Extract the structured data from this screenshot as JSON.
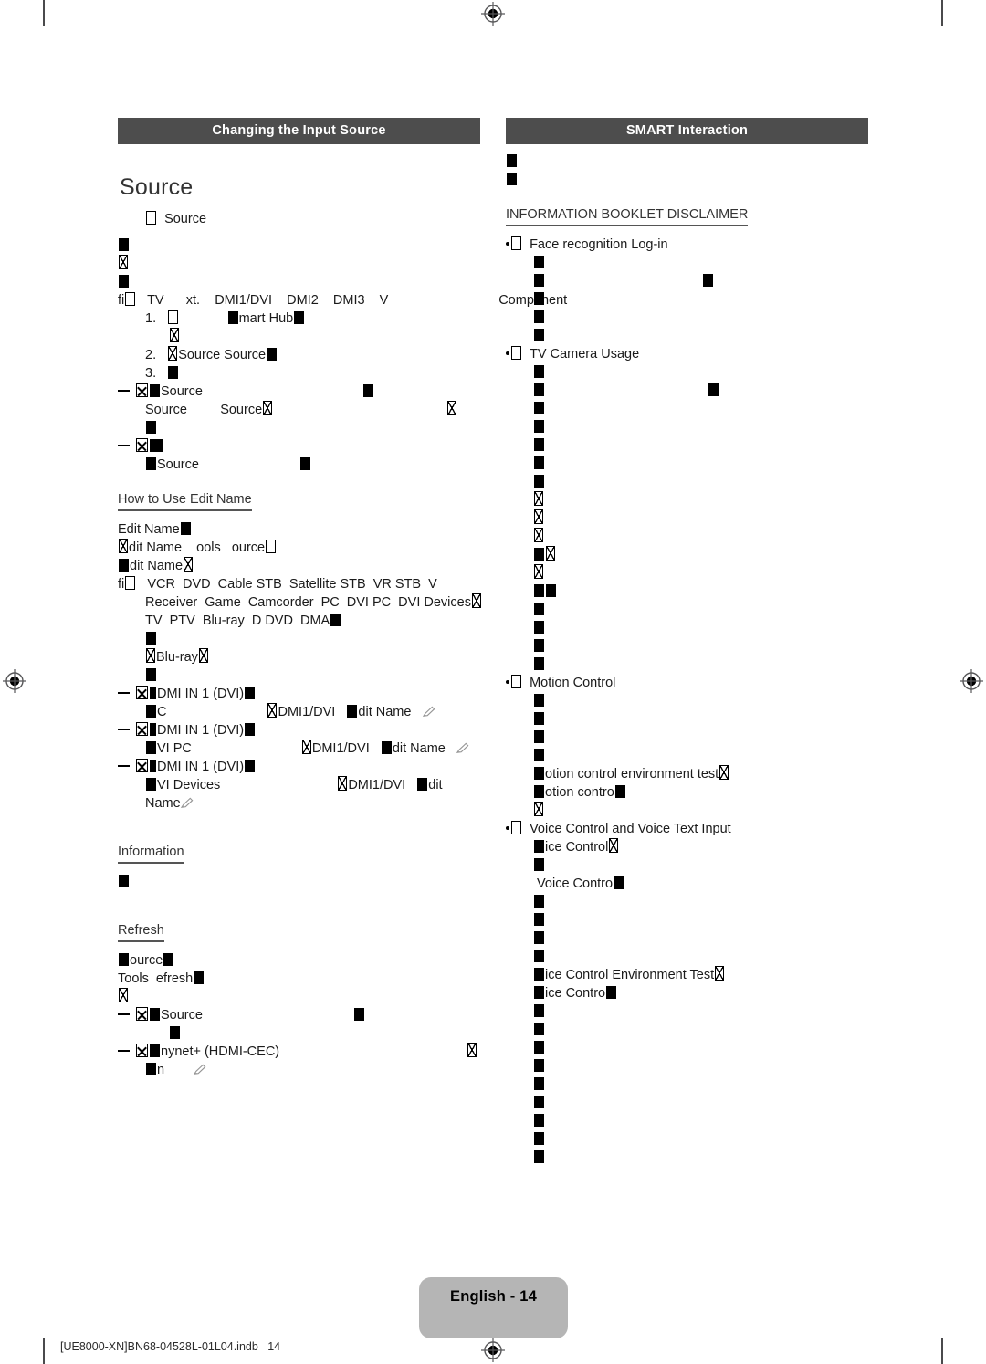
{
  "document": {
    "page_label": "English - 14",
    "file_reference": "[UE8000-XN]BN68-04528L-01L04.indb   14",
    "print_marks": {
      "registration_icon": "registration-target-icon",
      "crop_mark": "crop-mark"
    }
  },
  "left_column": {
    "section_bar": "Changing the Input Source",
    "heading": "Source",
    "menu_line": "Source",
    "input_list": "TV      xt.    DMI1/DVI    DMI2    DMI3    V                              Component",
    "steps": [
      {
        "num": "1.",
        "text": "mart Hub"
      },
      {
        "num": "2.",
        "text": "Source Source"
      },
      {
        "num": "3.",
        "text": ""
      }
    ],
    "note_1_title": "Source",
    "note_1_body": "Source         Source",
    "note_2_title": "",
    "note_2_body": "Source",
    "edit_name": {
      "heading": "How to Use Edit Name",
      "line1": "Edit Name",
      "line2": "dit Name    ools   ource",
      "line3": "dit Name",
      "list_line1": "VCR  DVD  Cable STB  Satellite STB  VR STB  V",
      "list_line2": "Receiver  Game  Camcorder  PC  DVI PC  DVI Devices",
      "list_line3": "TV  PTV  Blu-ray  D DVD  DMA",
      "list_line4": "",
      "list_line5": "Blu-ray",
      "items": [
        {
          "label": "DMI IN 1 (DVI)",
          "detail_left": "C",
          "detail_mid": "DMI1/DVI",
          "detail_right": "dit Name"
        },
        {
          "label": "DMI IN 1 (DVI)",
          "detail_left": "VI PC",
          "detail_mid": "DMI1/DVI",
          "detail_right": "dit Name"
        },
        {
          "label": "DMI IN 1 (DVI)",
          "detail_left": "VI Devices",
          "detail_mid": "DMI1/DVI",
          "detail_right": "dit"
        },
        {
          "label": "Name",
          "detail_left": "",
          "detail_mid": "",
          "detail_right": ""
        }
      ]
    },
    "information": {
      "heading": "Information"
    },
    "refresh": {
      "heading": "Refresh",
      "line1": "ource",
      "line2": "Tools  efresh",
      "sub1": "Source",
      "sub2": "nynet+ (HDMI-CEC)",
      "sub2_detail": "n"
    }
  },
  "right_column": {
    "section_bar": "SMART Interaction",
    "disclaimer_heading": "INFORMATION BOOKLET DISCLAIMER",
    "topics": [
      {
        "title": "Face recognition Log-in"
      },
      {
        "title": "TV Camera Usage"
      },
      {
        "title": "Motion Control"
      },
      {
        "title": "Voice Control and Voice Text Input"
      }
    ],
    "motion_control_lines": [
      "otion control environment test",
      "otion contro"
    ],
    "voice_lines": [
      "ice Control",
      "Voice Contro",
      "ice Control Environment Test",
      "ice Contro"
    ]
  },
  "colors": {
    "section_bar_bg": "#4d4d4d",
    "section_bar_text": "#ffffff",
    "page_pill_bg": "#b5b5b5",
    "body_text": "#1a1a1a",
    "heading_text": "#333333"
  }
}
